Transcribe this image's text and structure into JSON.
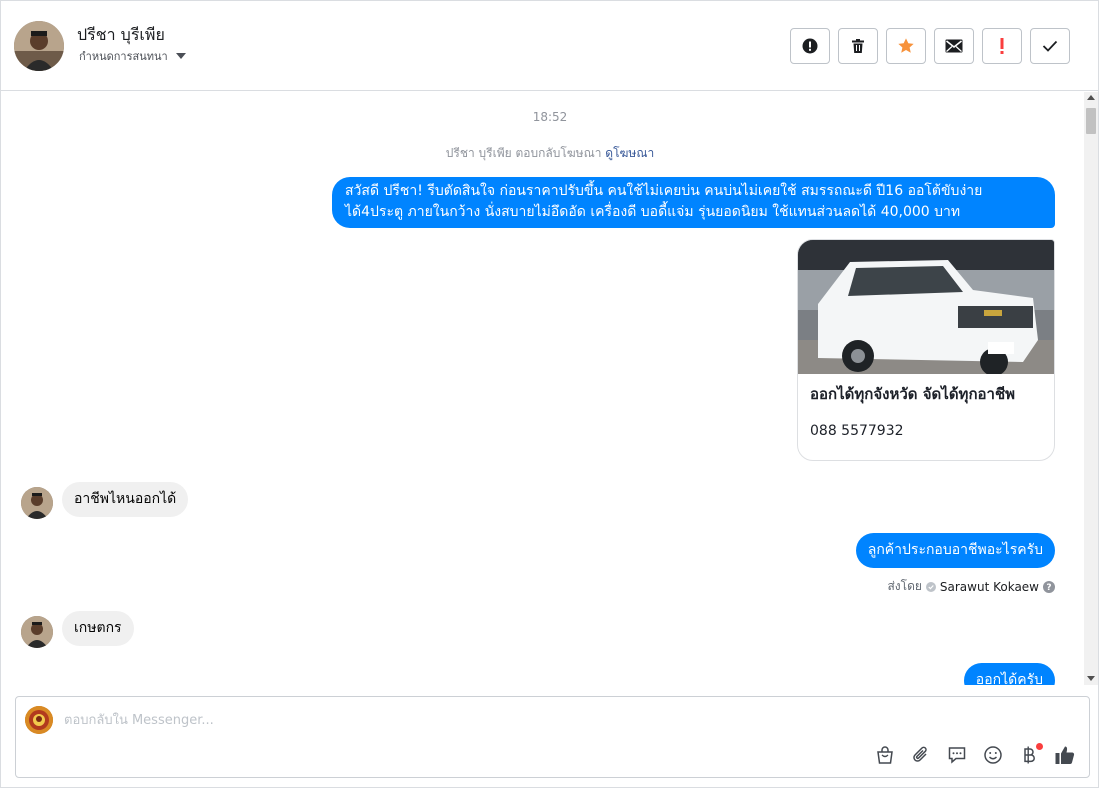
{
  "header": {
    "name": "ปรีชา บุรีเพีย",
    "subtitle": "กำหนดการสนทนา"
  },
  "toolbar": {
    "buttons": [
      {
        "icon": "alert-circle-icon"
      },
      {
        "icon": "trash-icon"
      },
      {
        "icon": "star-icon",
        "color": "#f7923b"
      },
      {
        "icon": "envelope-icon"
      },
      {
        "icon": "exclamation-icon",
        "color": "#fa3e3e"
      },
      {
        "icon": "checkmark-icon"
      }
    ]
  },
  "conversation": {
    "time": "18:52",
    "replied_prefix": "ปรีชา บุรีเพีย ตอบกลับโฆษณา",
    "replied_link": "ดูโฆษณา",
    "messages": {
      "m1": "สวัสดี ปรีชา! รีบตัดสินใจ ก่อนราคาปรับขึ้น คนใช้ไม่เคยบ่น คนบ่นไม่เคยใช้ สมรรถณะดี ปี16 ออโต้ขับง่าย ได้4ประตู ภายในกว้าง นั่งสบายไม่อึดอัด เครื่องดี บอดี้แจ่ม รุ่นยอดนิยม  ใช้แทนส่วนลดได้ 40,000 บาท",
      "card_title": "ออกได้ทุกจังหวัด จัดได้ทุกอาชีพ",
      "card_phone": "088 5577932",
      "m2": "อาชีพไหนออกได้",
      "m3": "ลูกค้าประกอบอาชีพอะไรครับ",
      "sent_by_label": "ส่งโดย",
      "sent_by_name": "Sarawut Kokaew",
      "m4": "เกษตกร",
      "m5": "ออกได้ครับ"
    }
  },
  "composer": {
    "placeholder": "ตอบกลับใน Messenger...",
    "tools": [
      "bag-icon",
      "paperclip-icon",
      "chat-bubble-icon",
      "smiley-icon",
      "baht-icon",
      "thumbs-up-icon"
    ]
  },
  "colors": {
    "accent": "#0084ff",
    "incoming": "#f0f0f0",
    "link": "#385898"
  }
}
